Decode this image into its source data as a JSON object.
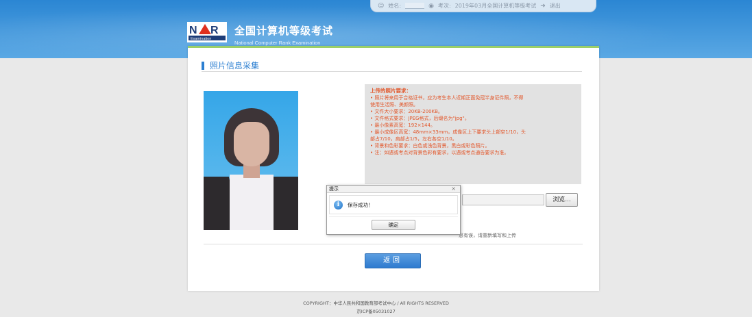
{
  "userbar": {
    "name_label": "姓名:",
    "exam_label": "考次:",
    "exam_value": "2019年03月全国计算机等级考试",
    "logout_label": "退出"
  },
  "header": {
    "title_cn": "全国计算机等级考试",
    "title_en": "National Computer Rank Examination",
    "logo_text": "Examination"
  },
  "section": {
    "title": "照片信息采集"
  },
  "requirements": {
    "heading": "上传的照片要求：",
    "lines": [
      "• 照片将来用于合格证书，应为考生本人近期正面免冠半身证件照，不得",
      "使用生活照、美颜照。",
      "• 文件大小要求：20KB-200KB。",
      "• 文件格式要求：JPEG格式，后缀名为\"jpg\"。",
      "• 最小像素高宽：192×144。",
      "• 最小成像区高宽：48mm×33mm，成像区上下要求头上部空1/10，头",
      "部占7/10，肩部占1/5，左右各空1/10。",
      "• 背景和色彩要求：白色或浅色背景，黑白或彩色照片。",
      "• 注：如遇或考点对背景色彩有要求，以遇或考点通告要求为准。"
    ]
  },
  "upload": {
    "browse_label": "浏览...",
    "hint": "息有误，请重新填写和上传"
  },
  "buttons": {
    "back": "返回"
  },
  "dialog": {
    "title": "提示",
    "close": "×",
    "message": "保存成功！",
    "ok": "确定"
  },
  "footer": {
    "copyright": "COPYRIGHT：中华人民共和国教育部考试中心 / All RIGHTS RESERVED",
    "icp": "京ICP备05031027"
  }
}
